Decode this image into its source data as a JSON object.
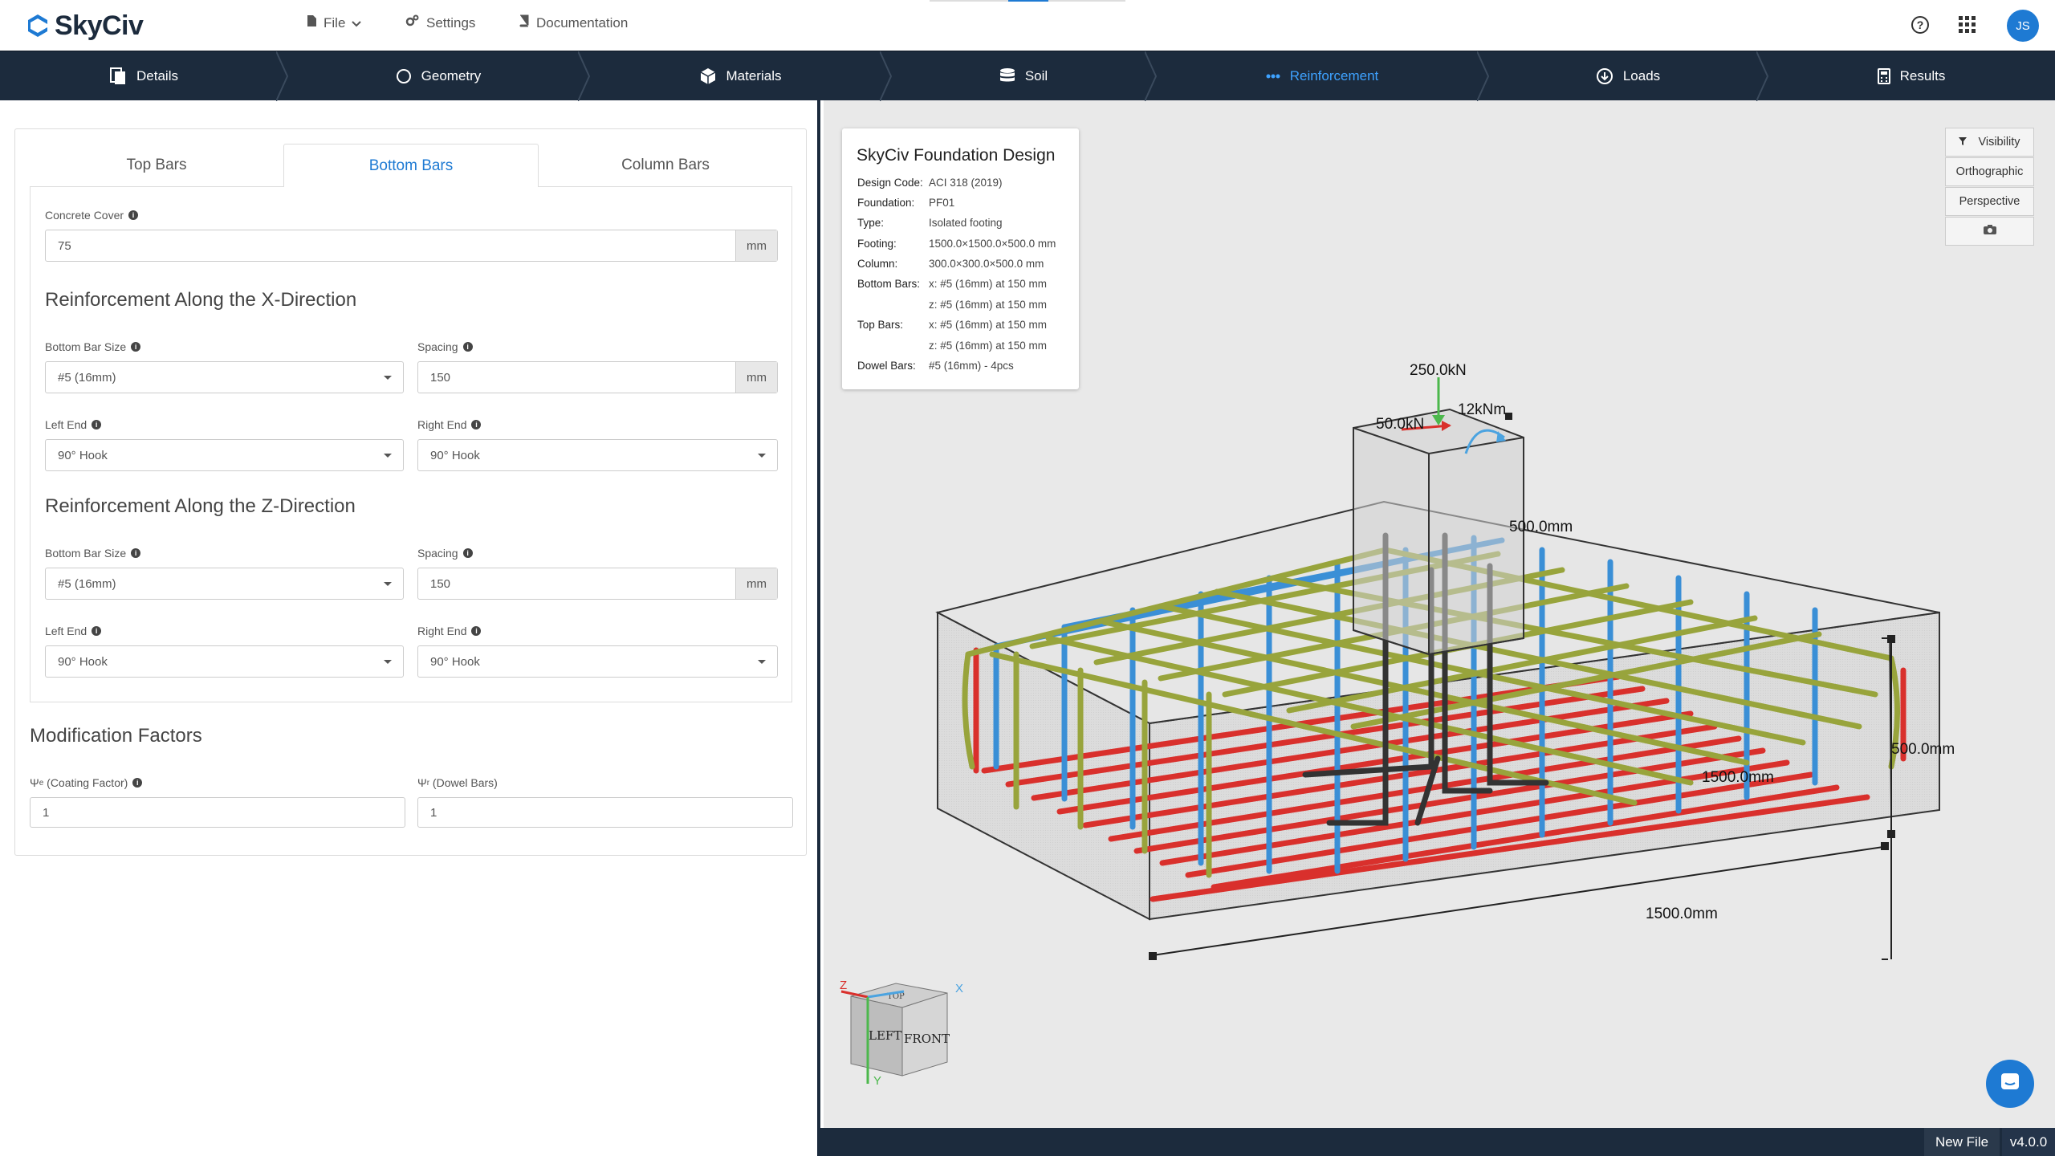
{
  "brand": {
    "name": "SkyCiv"
  },
  "top_menu": {
    "file": "File",
    "settings": "Settings",
    "documentation": "Documentation"
  },
  "user": {
    "initials": "JS"
  },
  "steps": [
    {
      "label": "Details",
      "icon": "document-icon"
    },
    {
      "label": "Geometry",
      "icon": "circle-icon"
    },
    {
      "label": "Materials",
      "icon": "cube-icon"
    },
    {
      "label": "Soil",
      "icon": "database-icon"
    },
    {
      "label": "Reinforcement",
      "icon": "dots-icon",
      "active": true
    },
    {
      "label": "Loads",
      "icon": "download-circle-icon"
    },
    {
      "label": "Results",
      "icon": "calculator-icon"
    }
  ],
  "tabs": {
    "top": "Top Bars",
    "bottom": "Bottom Bars",
    "column": "Column Bars"
  },
  "form": {
    "concrete_cover": {
      "label": "Concrete Cover",
      "value": "75",
      "unit": "mm"
    },
    "x_direction": {
      "heading": "Reinforcement Along the X-Direction",
      "bar_size_label": "Bottom Bar Size",
      "bar_size": "#5 (16mm)",
      "spacing_label": "Spacing",
      "spacing": "150",
      "spacing_unit": "mm",
      "left_end_label": "Left End",
      "left_end": "90° Hook",
      "right_end_label": "Right End",
      "right_end": "90° Hook"
    },
    "z_direction": {
      "heading": "Reinforcement Along the Z-Direction",
      "bar_size_label": "Bottom Bar Size",
      "bar_size": "#5 (16mm)",
      "spacing_label": "Spacing",
      "spacing": "150",
      "spacing_unit": "mm",
      "left_end_label": "Left End",
      "left_end": "90° Hook",
      "right_end_label": "Right End",
      "right_end": "90° Hook"
    },
    "modification": {
      "heading": "Modification Factors",
      "coating_label_psi": "Ψ",
      "coating_label_sub": "e",
      "coating_label_rest": " (Coating Factor)",
      "coating_value": "1",
      "dowel_label_psi": "Ψ",
      "dowel_label_sub": "r",
      "dowel_label_rest": " (Dowel Bars)",
      "dowel_value": "1"
    }
  },
  "summary": {
    "title": "SkyCiv Foundation Design",
    "rows": [
      {
        "k": "Design Code:",
        "v": "ACI 318 (2019)"
      },
      {
        "k": "Foundation:",
        "v": "PF01"
      },
      {
        "k": "Type:",
        "v": "Isolated footing"
      },
      {
        "k": "Footing:",
        "v": "1500.0×1500.0×500.0 mm"
      },
      {
        "k": "Column:",
        "v": "300.0×300.0×500.0 mm"
      },
      {
        "k": "Bottom Bars:",
        "v": "x: #5 (16mm) at 150 mm"
      },
      {
        "k": "",
        "v": "z: #5 (16mm) at 150 mm"
      },
      {
        "k": "Top Bars:",
        "v": "x: #5 (16mm) at 150 mm"
      },
      {
        "k": "",
        "v": "z: #5 (16mm) at 150 mm"
      },
      {
        "k": "Dowel Bars:",
        "v": "#5 (16mm) - 4pcs"
      }
    ]
  },
  "view_buttons": {
    "visibility": "Visibility",
    "orthographic": "Orthographic",
    "perspective": "Perspective"
  },
  "scene_labels": {
    "axial": "250.0kN",
    "shear": "50.0kN",
    "moment": "12kNm",
    "col_height": "500.0mm",
    "depth": "500.0mm",
    "width_z": "1500.0mm",
    "width_x": "1500.0mm"
  },
  "viewcube": {
    "top": "TOP",
    "left": "LEFT",
    "front": "FRONT",
    "axis_x": "X",
    "axis_y": "Y",
    "axis_z": "Z"
  },
  "status": {
    "file": "New File",
    "version": "v4.0.0"
  },
  "colors": {
    "navy": "#1c2b3d",
    "accent": "#1e7ad3",
    "active_step": "#3ea2ff",
    "bar_red": "#d9302c",
    "bar_blue": "#3a8fd6",
    "bar_olive": "#98a43c",
    "viewport_bg": "#e9e9e9"
  }
}
